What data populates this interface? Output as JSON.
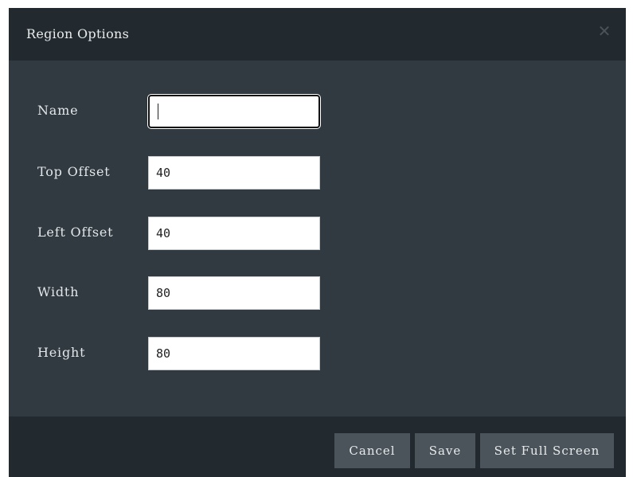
{
  "dialog": {
    "title": "Region Options",
    "close_icon": "close-icon",
    "close_glyph": "✕"
  },
  "form": {
    "fields": [
      {
        "label": "Name",
        "value": "",
        "focused": true
      },
      {
        "label": "Top Offset",
        "value": "40"
      },
      {
        "label": "Left Offset",
        "value": "40"
      },
      {
        "label": "Width",
        "value": "80"
      },
      {
        "label": "Height",
        "value": "80"
      }
    ]
  },
  "footer": {
    "cancel_label": "Cancel",
    "save_label": "Save",
    "fullscreen_label": "Set Full Screen"
  }
}
